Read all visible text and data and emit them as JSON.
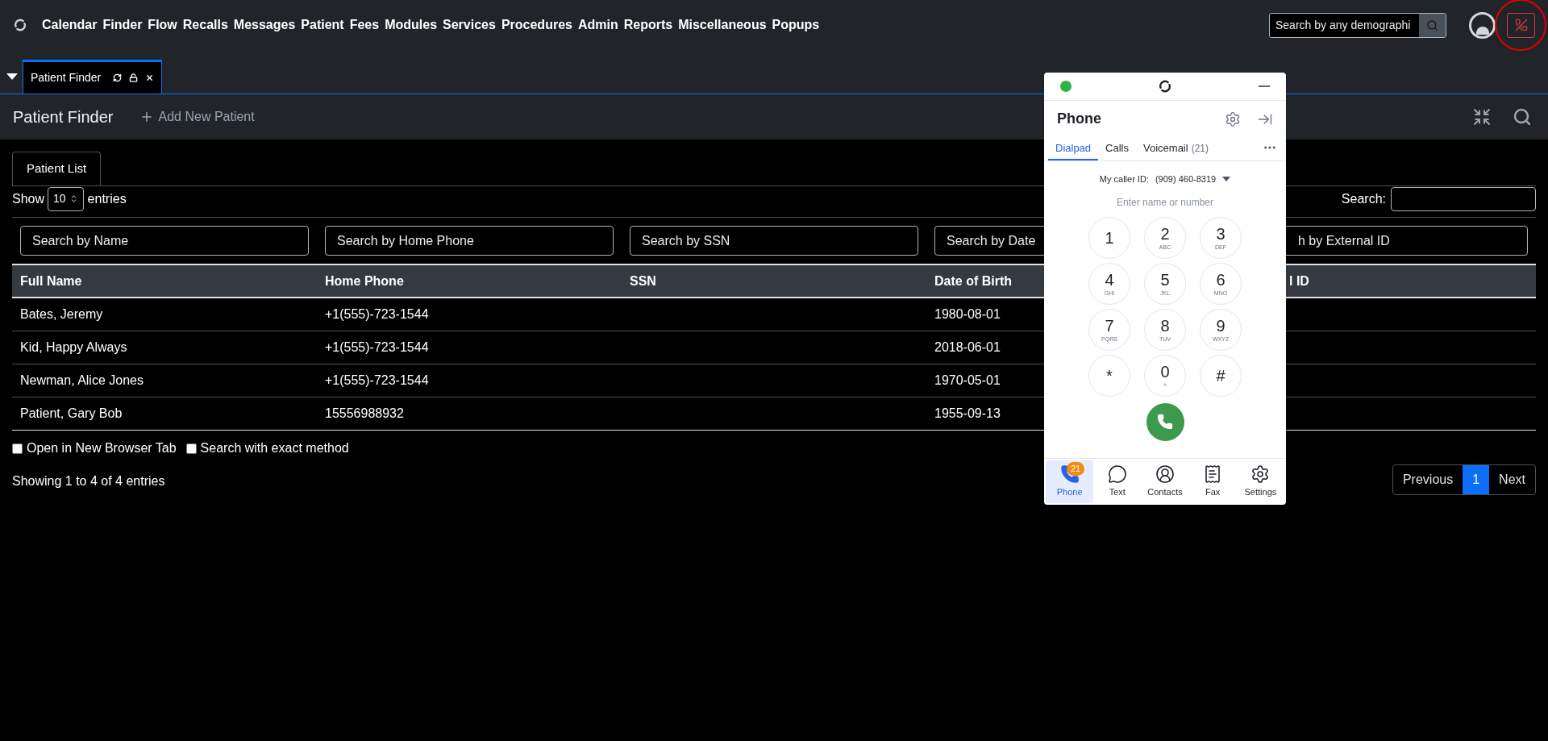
{
  "nav": {
    "items": [
      "Calendar",
      "Finder",
      "Flow",
      "Recalls",
      "Messages",
      "Patient",
      "Fees",
      "Modules",
      "Services",
      "Procedures",
      "Admin",
      "Reports",
      "Miscellaneous",
      "Popups"
    ],
    "search_placeholder": "Search by any demographi"
  },
  "tabs": [
    {
      "label": "Patient Finder",
      "selected": true
    }
  ],
  "header": {
    "title": "Patient Finder",
    "add_button": "Add New Patient"
  },
  "panel_tab": {
    "label": "Patient List",
    "selected": true
  },
  "length": {
    "show": "Show",
    "value": "10",
    "entries": "entries"
  },
  "search": {
    "label": "Search:"
  },
  "filters": [
    {
      "placeholder": "Search by Name"
    },
    {
      "placeholder": "Search by Home Phone"
    },
    {
      "placeholder": "Search by SSN"
    },
    {
      "placeholder": "Search by Date"
    },
    {
      "placeholder": "h by External ID"
    }
  ],
  "columns": [
    "Full Name",
    "Home Phone",
    "SSN",
    "Date of Birth",
    "l ID"
  ],
  "rows": [
    {
      "full_name": "Bates, Jeremy",
      "home_phone": "+1(555)-723-1544",
      "date_of_birth": "1980-08-01"
    },
    {
      "full_name": "Kid, Happy Always",
      "home_phone": "+1(555)-723-1544",
      "date_of_birth": "2018-06-01"
    },
    {
      "full_name": "Newman, Alice Jones",
      "home_phone": "+1(555)-723-1544",
      "date_of_birth": "1970-05-01"
    },
    {
      "full_name": "Patient, Gary Bob",
      "home_phone": "15556988932",
      "date_of_birth": "1955-09-13"
    }
  ],
  "options": [
    {
      "label": "Open in New Browser Tab",
      "checked": false
    },
    {
      "label": "Search with exact method",
      "checked": false
    }
  ],
  "info": "Showing 1 to 4 of 4 entries",
  "pagination": [
    {
      "label": "Previous",
      "selected": false
    },
    {
      "label": "1",
      "selected": true
    },
    {
      "label": "Next",
      "selected": false
    }
  ],
  "phone": {
    "online": true,
    "title": "Phone",
    "tabs": [
      {
        "label": "Dialpad",
        "selected": true
      },
      {
        "label": "Calls",
        "selected": false
      },
      {
        "label": "Voicemail",
        "count": "(21)",
        "selected": false
      }
    ],
    "caller_id_label": "My caller ID:",
    "caller_id": "(909) 460-8319",
    "placeholder": "Enter name or number",
    "keys": [
      {
        "digit": "1"
      },
      {
        "digit": "2",
        "letters": "ABC"
      },
      {
        "digit": "3",
        "letters": "DEF"
      },
      {
        "digit": "4",
        "letters": "GHI"
      },
      {
        "digit": "5",
        "letters": "JKL"
      },
      {
        "digit": "6",
        "letters": "MNO"
      },
      {
        "digit": "7",
        "letters": "PQRS"
      },
      {
        "digit": "8",
        "letters": "TUV"
      },
      {
        "digit": "9",
        "letters": "WXYZ"
      },
      {
        "digit": "*"
      },
      {
        "digit": "0",
        "letters": "+"
      },
      {
        "digit": "#"
      }
    ],
    "bottom_nav": [
      {
        "kind": "phone",
        "label": "Phone",
        "badge": "21",
        "selected": true
      },
      {
        "kind": "text",
        "label": "Text",
        "selected": false
      },
      {
        "kind": "contacts",
        "label": "Contacts",
        "selected": false
      },
      {
        "kind": "fax",
        "label": "Fax",
        "selected": false
      },
      {
        "kind": "settings",
        "label": "Settings",
        "selected": false
      }
    ]
  }
}
